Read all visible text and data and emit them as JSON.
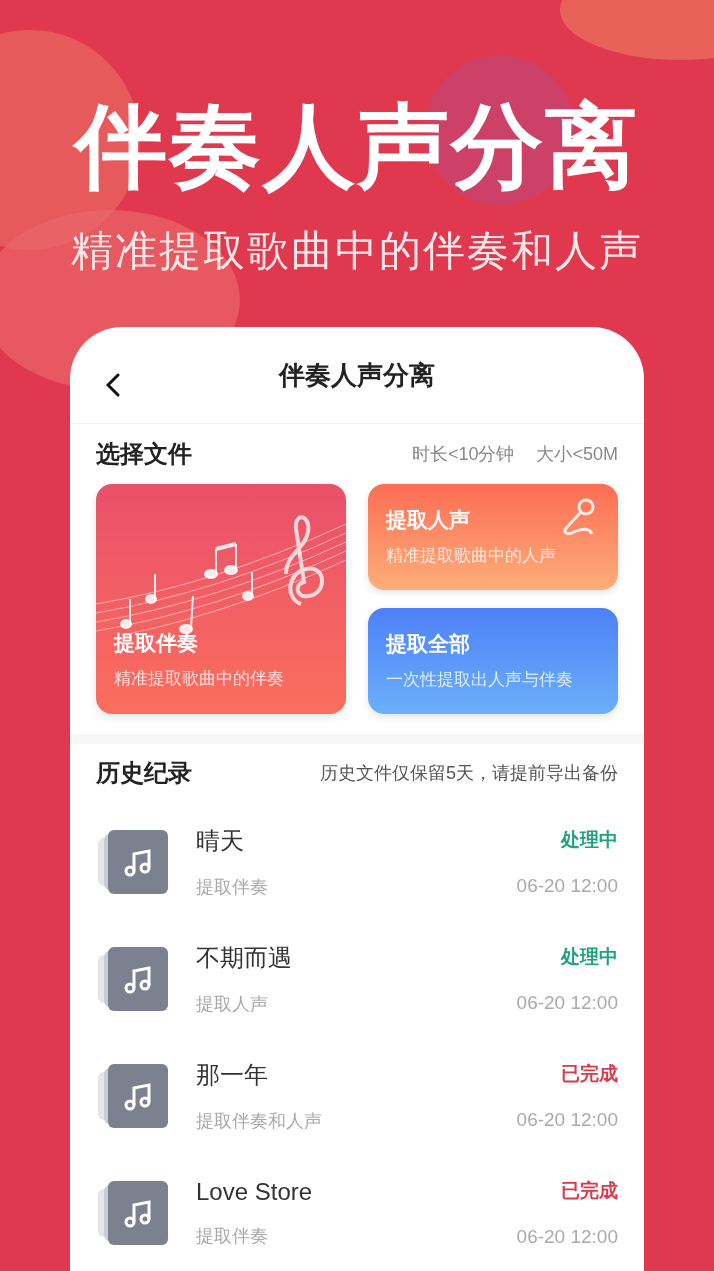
{
  "hero": {
    "title": "伴奏人声分离",
    "subtitle": "精准提取歌曲中的伴奏和人声"
  },
  "screen": {
    "title": "伴奏人声分离",
    "files": {
      "heading": "选择文件",
      "limits": [
        "时长<10分钟",
        "大小<50M"
      ],
      "options": [
        {
          "kind": "accompaniment",
          "title": "提取伴奏",
          "desc": "精准提取歌曲中的伴奏"
        },
        {
          "kind": "vocal",
          "title": "提取人声",
          "desc": "精准提取歌曲中的人声"
        },
        {
          "kind": "all",
          "title": "提取全部",
          "desc": "一次性提取出人声与伴奏"
        }
      ]
    },
    "history": {
      "heading": "历史纪录",
      "note": "历史文件仅保留5天，请提前导出备份",
      "items": [
        {
          "name": "晴天",
          "type": "提取伴奏",
          "status": "处理中",
          "kind": "processing",
          "time": "06-20 12:00"
        },
        {
          "name": "不期而遇",
          "type": "提取人声",
          "status": "处理中",
          "kind": "processing",
          "time": "06-20 12:00"
        },
        {
          "name": "那一年",
          "type": "提取伴奏和人声",
          "status": "已完成",
          "kind": "done",
          "time": "06-20 12:00"
        },
        {
          "name": "Love Store",
          "type": "提取伴奏",
          "status": "已完成",
          "kind": "done",
          "time": "06-20 12:00"
        }
      ]
    }
  }
}
